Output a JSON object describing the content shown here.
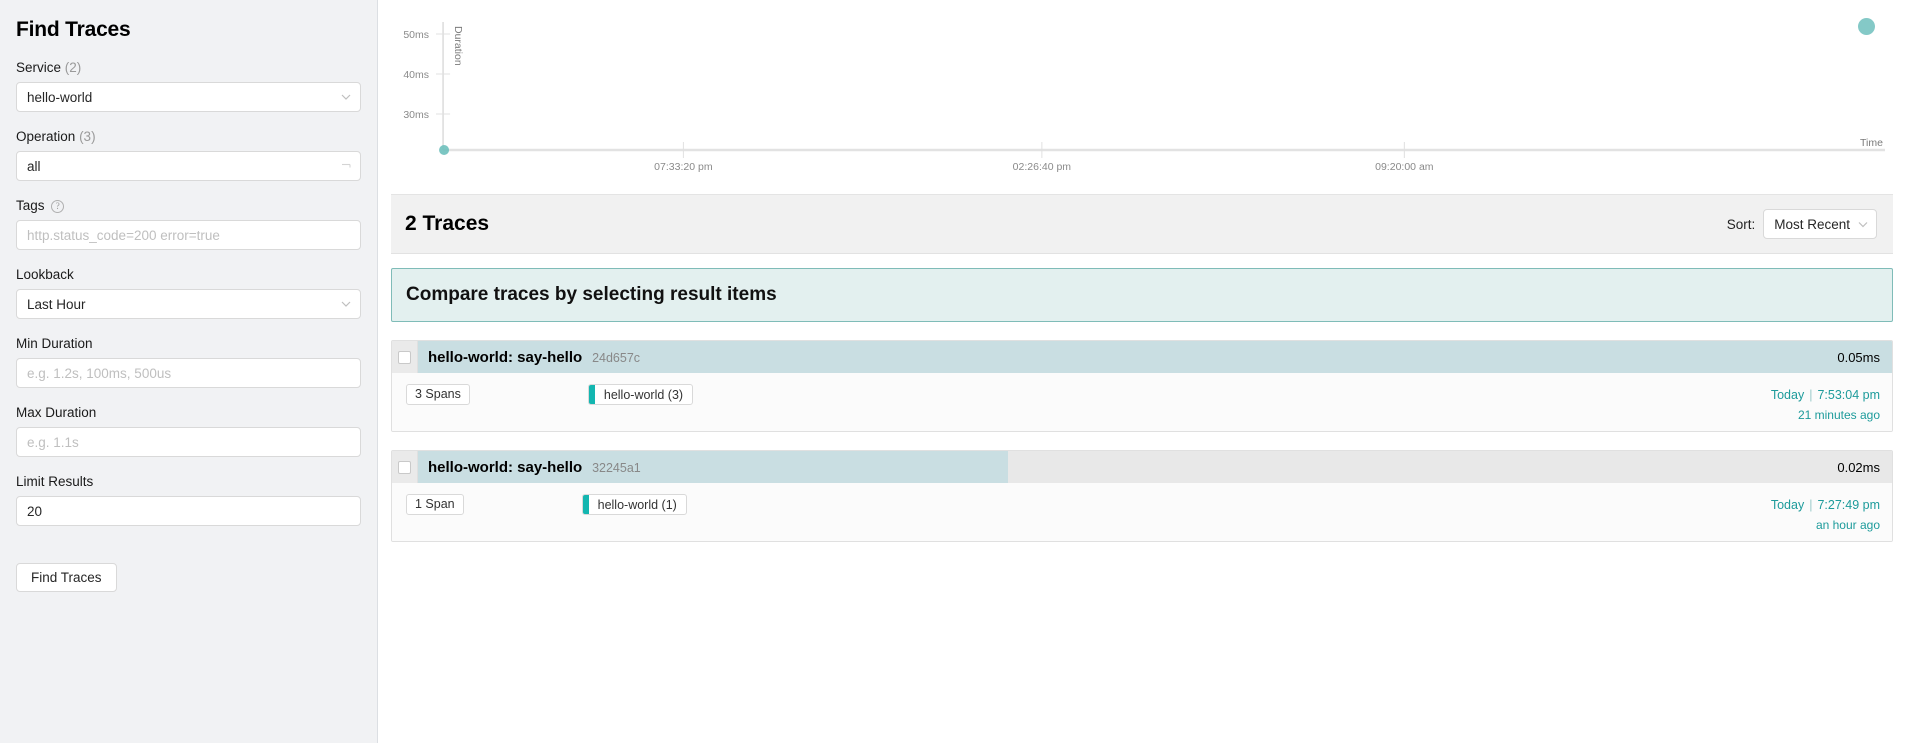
{
  "sidebar": {
    "title": "Find Traces",
    "fields": {
      "service": {
        "label": "Service",
        "count": "(2)",
        "value": "hello-world"
      },
      "operation": {
        "label": "Operation",
        "count": "(3)",
        "value": "all"
      },
      "tags": {
        "label": "Tags",
        "help_icon": "question-circle-icon",
        "placeholder": "http.status_code=200 error=true",
        "value": ""
      },
      "lookback": {
        "label": "Lookback",
        "value": "Last Hour"
      },
      "min_duration": {
        "label": "Min Duration",
        "placeholder": "e.g. 1.2s, 100ms, 500us",
        "value": ""
      },
      "max_duration": {
        "label": "Max Duration",
        "placeholder": "e.g. 1.1s",
        "value": ""
      },
      "limit_results": {
        "label": "Limit Results",
        "value": "20"
      }
    },
    "submit_label": "Find Traces"
  },
  "chart_data": {
    "type": "scatter",
    "title": "",
    "xlabel": "Time",
    "ylabel": "Duration",
    "y_ticks": [
      "30ms",
      "40ms",
      "50ms"
    ],
    "y_tick_values": [
      30,
      40,
      50
    ],
    "x_ticks": [
      "07:33:20 pm",
      "02:26:40 pm",
      "09:20:00 am"
    ],
    "ylim": [
      25,
      55
    ],
    "grid": false,
    "legend_position": "top-right",
    "point_color": "#6ec0bd",
    "points": [
      {
        "x": "07:33:20 pm",
        "y": 25,
        "label": "0.05ms"
      }
    ]
  },
  "results": {
    "count_label": "2 Traces",
    "sort_label": "Sort:",
    "sort_value": "Most Recent",
    "compare_banner": "Compare traces by selecting result items",
    "traces": [
      {
        "name": "hello-world: say-hello",
        "id": "24d657c",
        "duration": "0.05ms",
        "bar_percent": 100,
        "spans": "3 Spans",
        "service_pill": "hello-world (3)",
        "service_color": "#13b6b0",
        "day": "Today",
        "time": "7:53:04 pm",
        "relative": "21 minutes ago"
      },
      {
        "name": "hello-world: say-hello",
        "id": "32245a1",
        "duration": "0.02ms",
        "bar_percent": 40,
        "spans": "1 Span",
        "service_pill": "hello-world (1)",
        "service_color": "#13b6b0",
        "day": "Today",
        "time": "7:27:49 pm",
        "relative": "an hour ago"
      }
    ]
  },
  "colors": {
    "accent_teal": "#13b6b0",
    "banner_bg": "#e3f0ef",
    "banner_border": "#7fbcb8",
    "bar_fill": "#c9dee2",
    "sidebar_bg": "#f1f2f4"
  }
}
